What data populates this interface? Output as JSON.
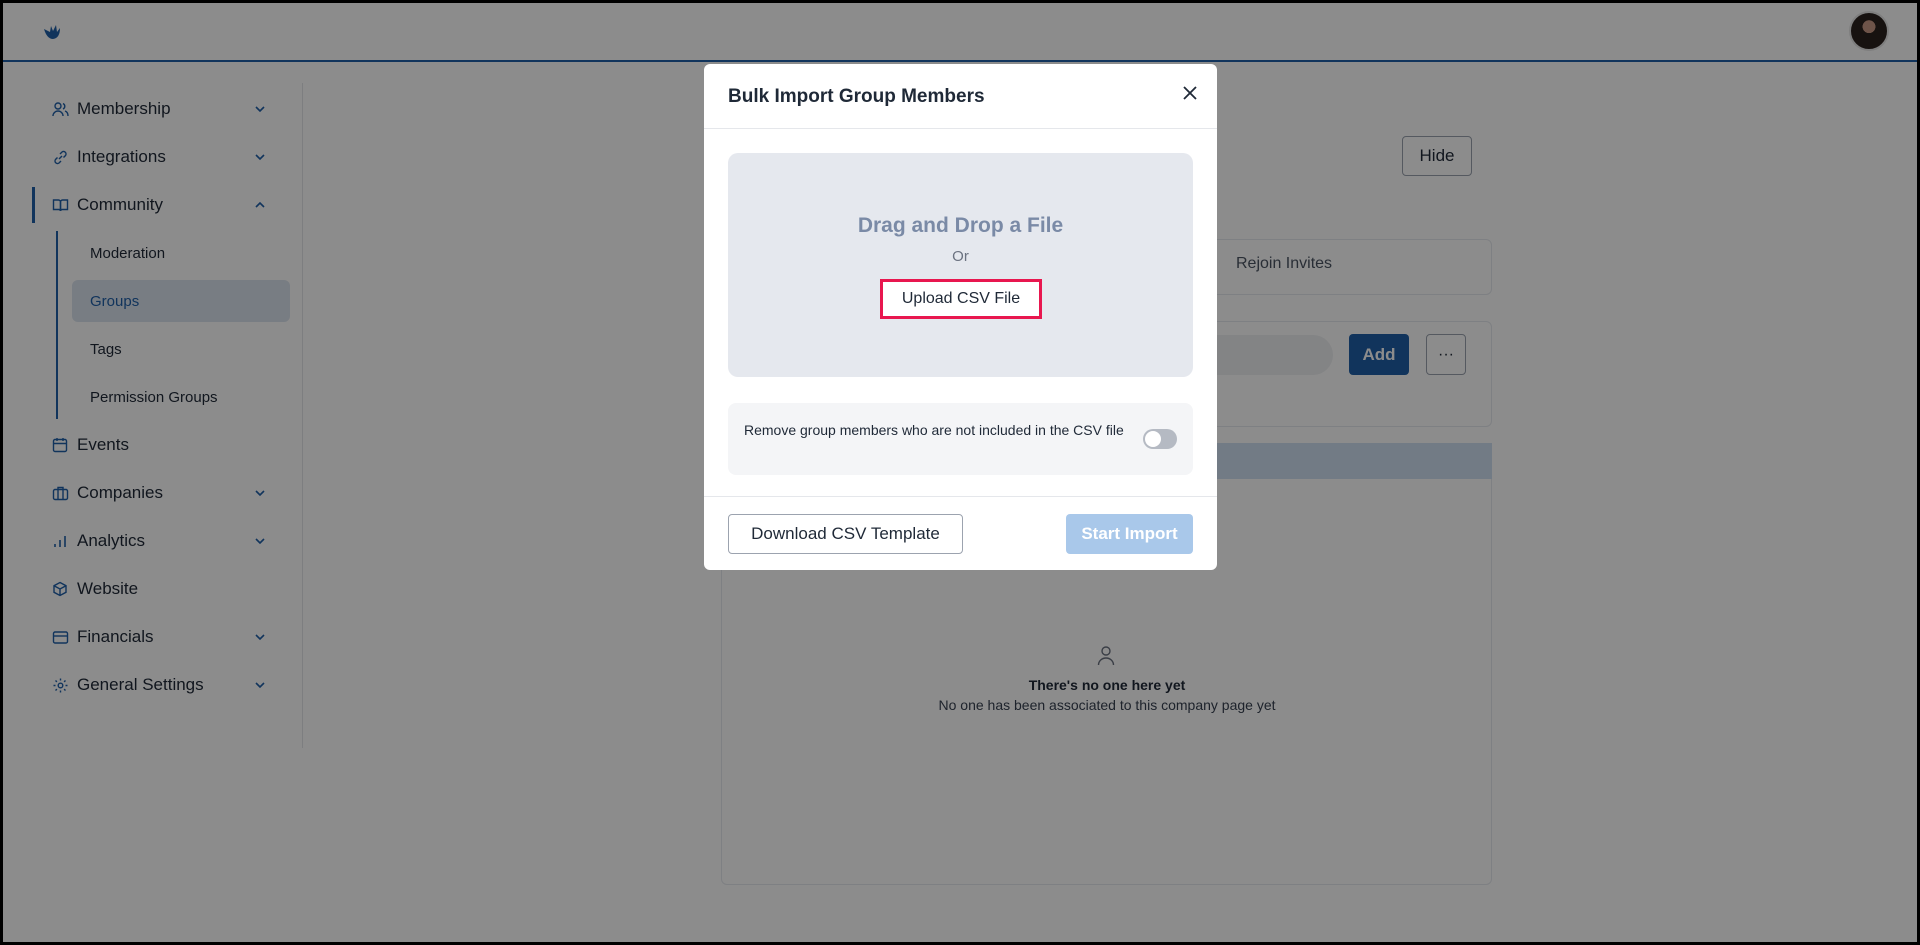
{
  "sidebar": {
    "items": [
      {
        "label": "Membership",
        "icon": "users-icon"
      },
      {
        "label": "Integrations",
        "icon": "link-icon"
      },
      {
        "label": "Community",
        "icon": "book-icon"
      },
      {
        "label": "Events",
        "icon": "calendar-icon"
      },
      {
        "label": "Companies",
        "icon": "briefcase-icon"
      },
      {
        "label": "Analytics",
        "icon": "bar-chart-icon"
      },
      {
        "label": "Website",
        "icon": "cube-icon"
      },
      {
        "label": "Financials",
        "icon": "credit-card-icon"
      },
      {
        "label": "General Settings",
        "icon": "gear-icon"
      }
    ],
    "community_subitems": [
      {
        "label": "Moderation"
      },
      {
        "label": "Groups"
      },
      {
        "label": "Tags"
      },
      {
        "label": "Permission Groups"
      }
    ]
  },
  "background": {
    "hide_label": "Hide",
    "tab_label": "Rejoin Invites",
    "add_label": "Add",
    "more_label": "···",
    "empty_title": "There's no one here yet",
    "empty_subtitle": "No one has been associated to this company page yet"
  },
  "modal": {
    "title": "Bulk Import Group Members",
    "dropzone_title": "Drag and Drop a File",
    "dropzone_or": "Or",
    "upload_label": "Upload CSV File",
    "toggle_label": "Remove group members who are not included in the CSV file",
    "download_label": "Download CSV Template",
    "start_label": "Start Import"
  },
  "colors": {
    "accent": "#1f5fa8",
    "highlight": "#e8174f",
    "disabled_button": "#a9c8ea"
  }
}
